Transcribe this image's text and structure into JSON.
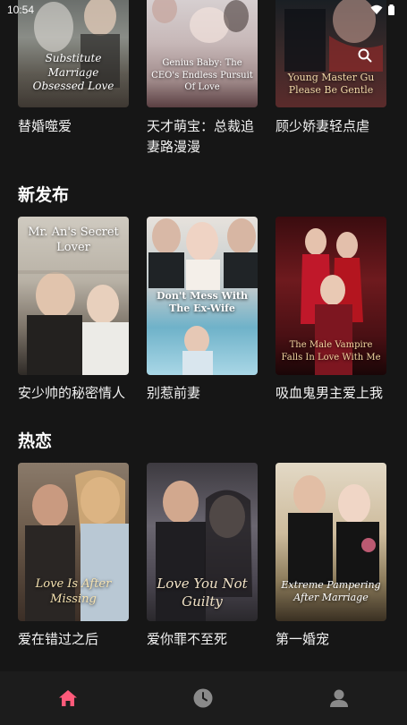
{
  "status_bar": {
    "time": "10:54"
  },
  "row1": [
    {
      "cover_text": "Substitute Marriage Obsessed Love",
      "title": "替婚噬爱"
    },
    {
      "cover_text": "Genius Baby: The CEO's Endless Pursuit Of Love",
      "title": "天才萌宝：总裁追妻路漫漫"
    },
    {
      "cover_text": "Young Master Gu Please Be Gentle",
      "title": "顾少娇妻轻点虐"
    }
  ],
  "sections": [
    {
      "heading": "新发布",
      "items": [
        {
          "cover_text": "Mr. An's Secret Lover",
          "title": "安少帅的秘密情人"
        },
        {
          "cover_text": "Don't Mess With The Ex-Wife",
          "title": "别惹前妻"
        },
        {
          "cover_text": "The Male Vampire Falls In Love With Me",
          "title": "吸血鬼男主爱上我"
        }
      ]
    },
    {
      "heading": "热恋",
      "items": [
        {
          "cover_text": "Love Is After Missing",
          "title": "爱在错过之后"
        },
        {
          "cover_text": "Love You Not Guilty",
          "title": "爱你罪不至死"
        },
        {
          "cover_text": "Extreme Pampering After Marriage",
          "title": "第一婚宠"
        }
      ]
    }
  ],
  "nav": {
    "active_color": "#ff5a7a",
    "inactive_color": "#8a8a8a"
  }
}
